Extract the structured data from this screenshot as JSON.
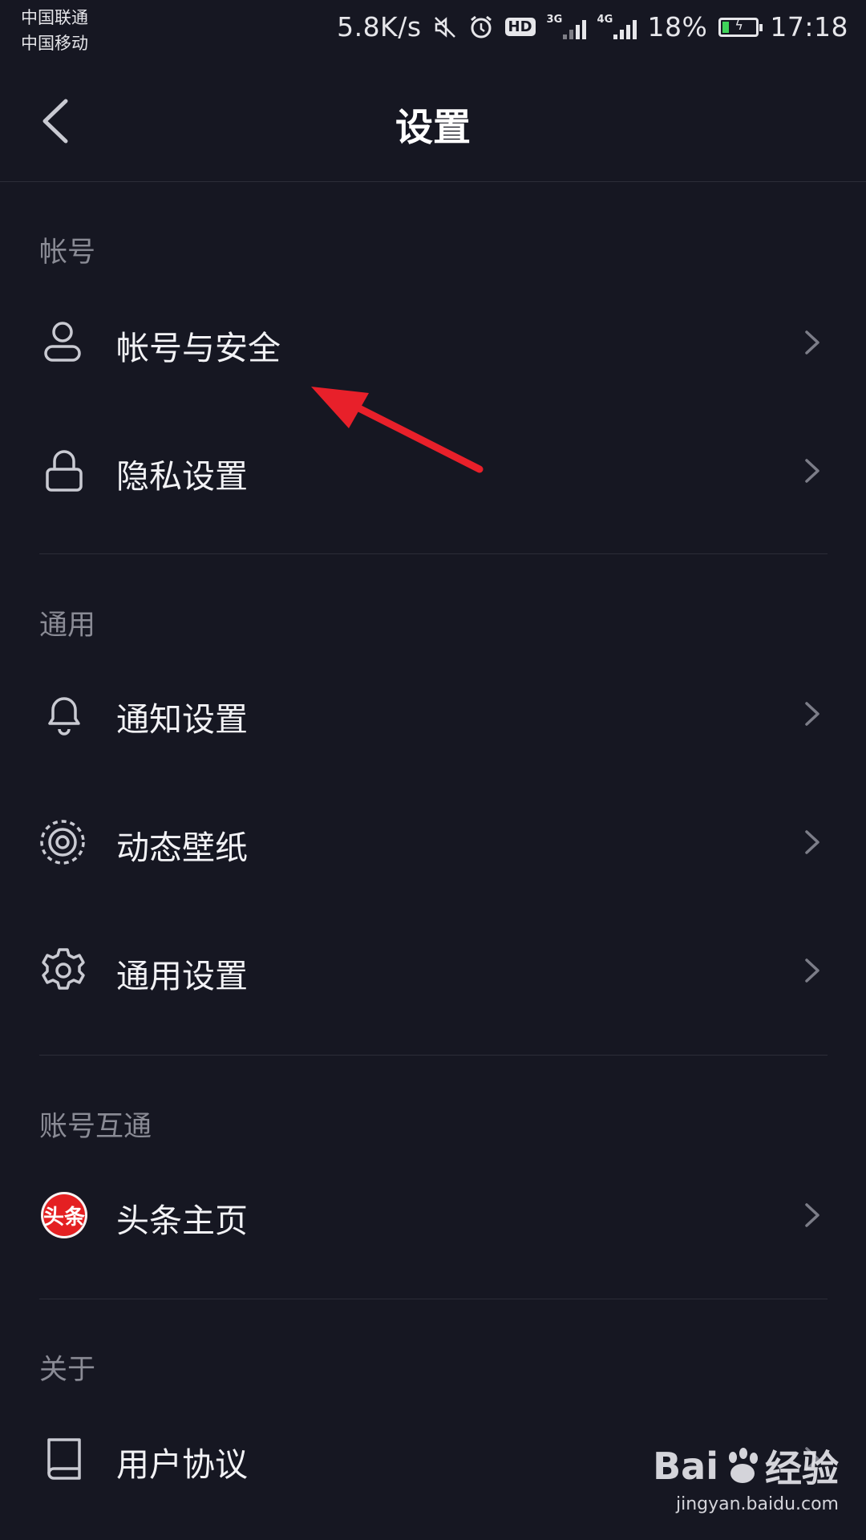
{
  "status_bar": {
    "carrier_1": "中国联通",
    "carrier_2": "中国移动",
    "net_speed": "5.8K/s",
    "hd_label": "HD",
    "sim1_network": "3G",
    "sim2_network": "4G",
    "battery": "18%",
    "time": "17:18",
    "icons": [
      "mute-icon",
      "alarm-icon",
      "signal-icon",
      "battery-charging-icon"
    ]
  },
  "header": {
    "title": "设置",
    "back_icon": "chevron-left-icon"
  },
  "sections": [
    {
      "title": "帐号",
      "items": [
        {
          "label": "帐号与安全",
          "icon": "user-icon"
        },
        {
          "label": "隐私设置",
          "icon": "lock-icon"
        }
      ]
    },
    {
      "title": "通用",
      "items": [
        {
          "label": "通知设置",
          "icon": "bell-icon"
        },
        {
          "label": "动态壁纸",
          "icon": "wallpaper-icon"
        },
        {
          "label": "通用设置",
          "icon": "gear-icon"
        }
      ]
    },
    {
      "title": "账号互通",
      "items": [
        {
          "label": "头条主页",
          "icon": "toutiao-logo",
          "logo_text": "头条"
        }
      ]
    },
    {
      "title": "关于",
      "items": [
        {
          "label": "用户协议",
          "icon": "book-icon"
        }
      ]
    }
  ],
  "annotation": {
    "arrow_color": "#e8202a"
  },
  "watermark": {
    "brand_left": "Bai",
    "brand_right": "经验",
    "url": "jingyan.baidu.com"
  },
  "colors": {
    "background": "#161722",
    "section_title": "#8a8b95",
    "divider": "#2c2d38"
  }
}
